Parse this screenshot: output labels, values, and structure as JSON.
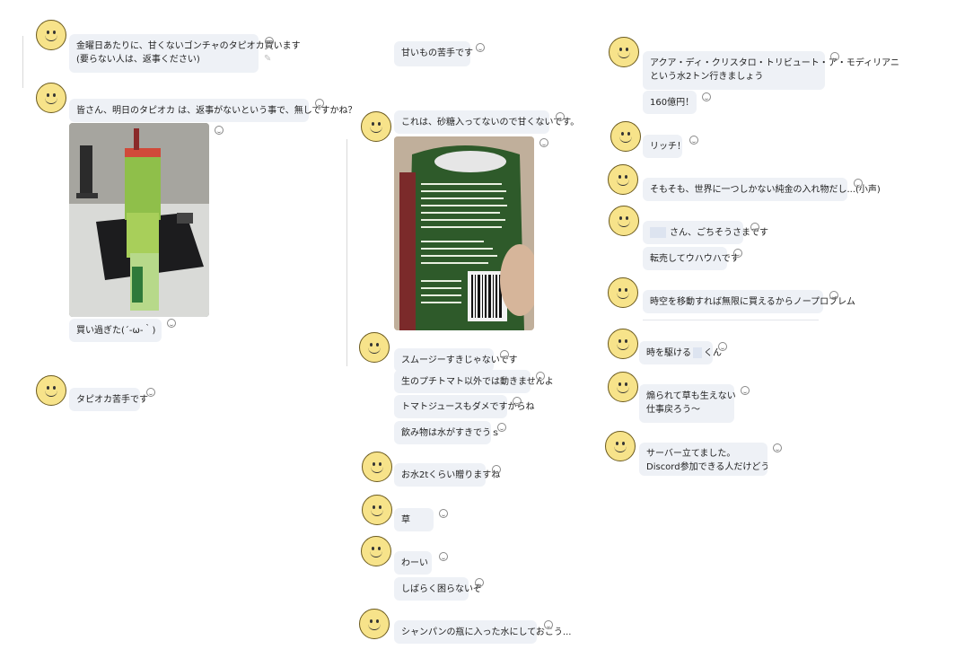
{
  "messages": {
    "m1": {
      "line1": "金曜日あたりに、甘くないゴンチャのタピオカ買います",
      "line2": "(要らない人は、返事ください)"
    },
    "m2": "皆さん、明日のタピオカ は、返事がないという事で、無しですかね？",
    "m3": "買い過ぎた(´-ω-｀)",
    "m4": "タピオカ苦手です",
    "m5": "甘いもの苦手です",
    "m6": "これは、砂糖入ってないので甘くないです。",
    "m7": "スムージーすきじゃないです",
    "m8": "生のプチトマト以外では動きませんよ",
    "m9": "トマトジュースもダメですからね",
    "m10": "飲み物は水がすきでうｓ",
    "m11": "お水2tくらい贈りますね",
    "m12": "草",
    "m13": "わーい",
    "m14": "しばらく困らないぞ",
    "m15": "シャンパンの瓶に入った水にしておこう...",
    "m16": {
      "line1": "アクア・ディ・クリスタロ・トリビュート・ア・モディリアニ",
      "line2": "という水2トン行きましょう"
    },
    "m17": "160億円！",
    "m18": "リッチ！",
    "m19": "そもそも、世界に一つしかない純金の入れ物だし...(小声)",
    "m20": "さん、ごちそうさまです",
    "m21": "転売してウハウハです",
    "m22": "時空を移動すれば無限に買えるからノープロブレム",
    "m23a": "時を駆ける",
    "m23b": "くん",
    "m24": {
      "line1": "煽られて草も生えない",
      "line2": "仕事戻ろう〜"
    },
    "m25": {
      "line1": "サーバー立てました。",
      "line2": "Discord参加できる人だけどうぞー"
    }
  },
  "photos": {
    "p1": "photo-stacked-drink-cups",
    "p2": "photo-drink-cup-label"
  },
  "icons": {
    "avatar": "smiley-face-icon",
    "reaction": "add-reaction-icon",
    "edit": "pencil-icon"
  },
  "colors": {
    "bubble": "#eef1f6",
    "avatar_fill": "#f7e38a",
    "background": "#ffffff"
  }
}
